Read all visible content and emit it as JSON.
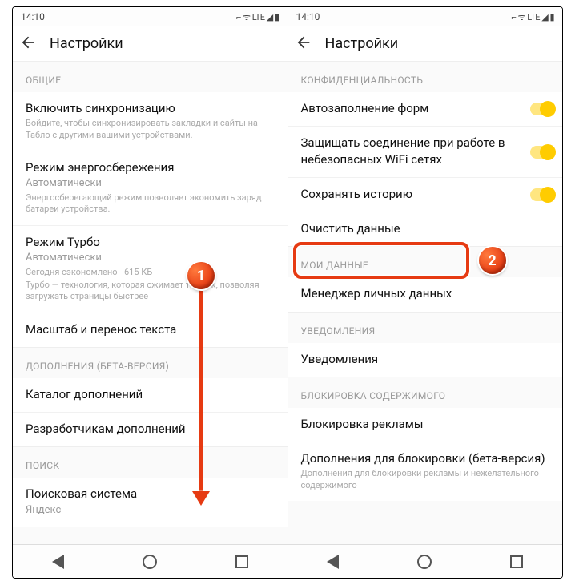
{
  "status": {
    "time": "14:10",
    "icons": "⌐  ᯤ  LTE ◢ ▮"
  },
  "appbar": {
    "title": "Настройки"
  },
  "left": {
    "sec_general": "ОБЩИЕ",
    "sync_title": "Включить синхронизацию",
    "sync_desc": "Войдите, чтобы синхронизировать закладки и сайты на Табло с другими вашими устройствами.",
    "power_title": "Режим энергосбережения",
    "power_sub": "Автоматически",
    "power_desc": "Энергосберегающий режим позволяет экономить заряд батареи устройства.",
    "turbo_title": "Режим Турбо",
    "turbo_sub": "Автоматически",
    "turbo_desc1": "Сегодня сэкономлено - 615 КБ",
    "turbo_desc2": "Турбо — технология, которая сжимает трафик, позволяя загружать страницы быстрее",
    "zoom_title": "Масштаб и перенос текста",
    "sec_addons": "ДОПОЛНЕНИЯ (БЕТА-ВЕРСИЯ)",
    "catalog": "Каталог дополнений",
    "devs": "Разработчикам дополнений",
    "sec_search": "ПОИСК",
    "engine_title": "Поисковая система",
    "engine_sub": "Яндекс"
  },
  "right": {
    "sec_privacy": "КОНФИДЕНЦИАЛЬНОСТЬ",
    "autofill": "Автозаполнение форм",
    "protect": "Защищать соединение при работе в небезопасных WiFi сетях",
    "history": "Сохранять историю",
    "clear": "Очистить данные",
    "sec_mydata": "МОИ ДАННЫЕ",
    "manager": "Менеджер личных данных",
    "sec_notif": "УВЕДОМЛЕНИЯ",
    "notif": "Уведомления",
    "sec_block": "БЛОКИРОВКА СОДЕРЖИМОГО",
    "adblock": "Блокировка рекламы",
    "addons_block": "Дополнения для блокировки (бета-версия)",
    "addons_desc": "Дополнения для блокировки рекламы и нежелательного содержимого"
  },
  "annot": {
    "b1": "1",
    "b2": "2"
  }
}
